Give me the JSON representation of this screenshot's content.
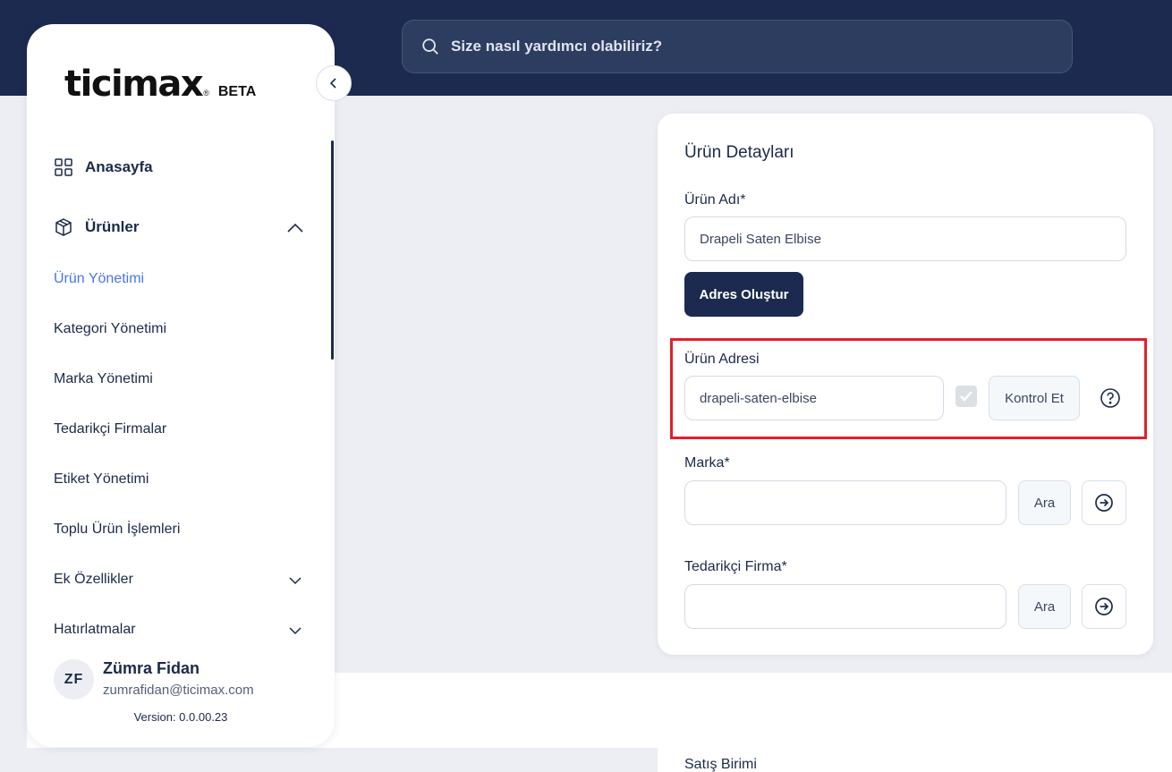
{
  "header": {
    "search_placeholder": "Size nasıl yardımcı olabiliriz?"
  },
  "sidebar": {
    "logo_text": "ticimax",
    "logo_badge": "BETA",
    "main_items": [
      {
        "label": "Anasayfa",
        "icon": "grid-icon"
      },
      {
        "label": "Ürünler",
        "icon": "box-icon",
        "expanded": true
      }
    ],
    "sub_items": [
      {
        "label": "Ürün Yönetimi",
        "active": true
      },
      {
        "label": "Kategori Yönetimi"
      },
      {
        "label": "Marka Yönetimi"
      },
      {
        "label": "Tedarikçi Firmalar"
      },
      {
        "label": "Etiket Yönetimi"
      },
      {
        "label": "Toplu Ürün İşlemleri"
      },
      {
        "label": "Ek Özellikler",
        "expandable": true
      },
      {
        "label": "Hatırlatmalar",
        "expandable": true
      }
    ],
    "user": {
      "initials": "ZF",
      "name": "Zümra Fidan",
      "email": "zumrafidan@ticimax.com"
    },
    "version": "Version: 0.0.00.23"
  },
  "card": {
    "title": "Ürün Detayları",
    "product_name_label": "Ürün Adı*",
    "product_name_value": "Drapeli Saten Elbise",
    "create_address_button": "Adres Oluştur",
    "product_address_label": "Ürün Adresi",
    "product_address_value": "drapeli-saten-elbise",
    "check_button": "Kontrol Et",
    "brand_label": "Marka*",
    "brand_value": "",
    "brand_search_button": "Ara",
    "supplier_label": "Tedarikçi Firma*",
    "supplier_value": "",
    "supplier_search_button": "Ara"
  },
  "below": {
    "sales_unit_label": "Satış Birimi"
  },
  "colors": {
    "header_bg": "#1b2a4e",
    "accent_active": "#4a74e8",
    "highlight": "#e0202a"
  }
}
